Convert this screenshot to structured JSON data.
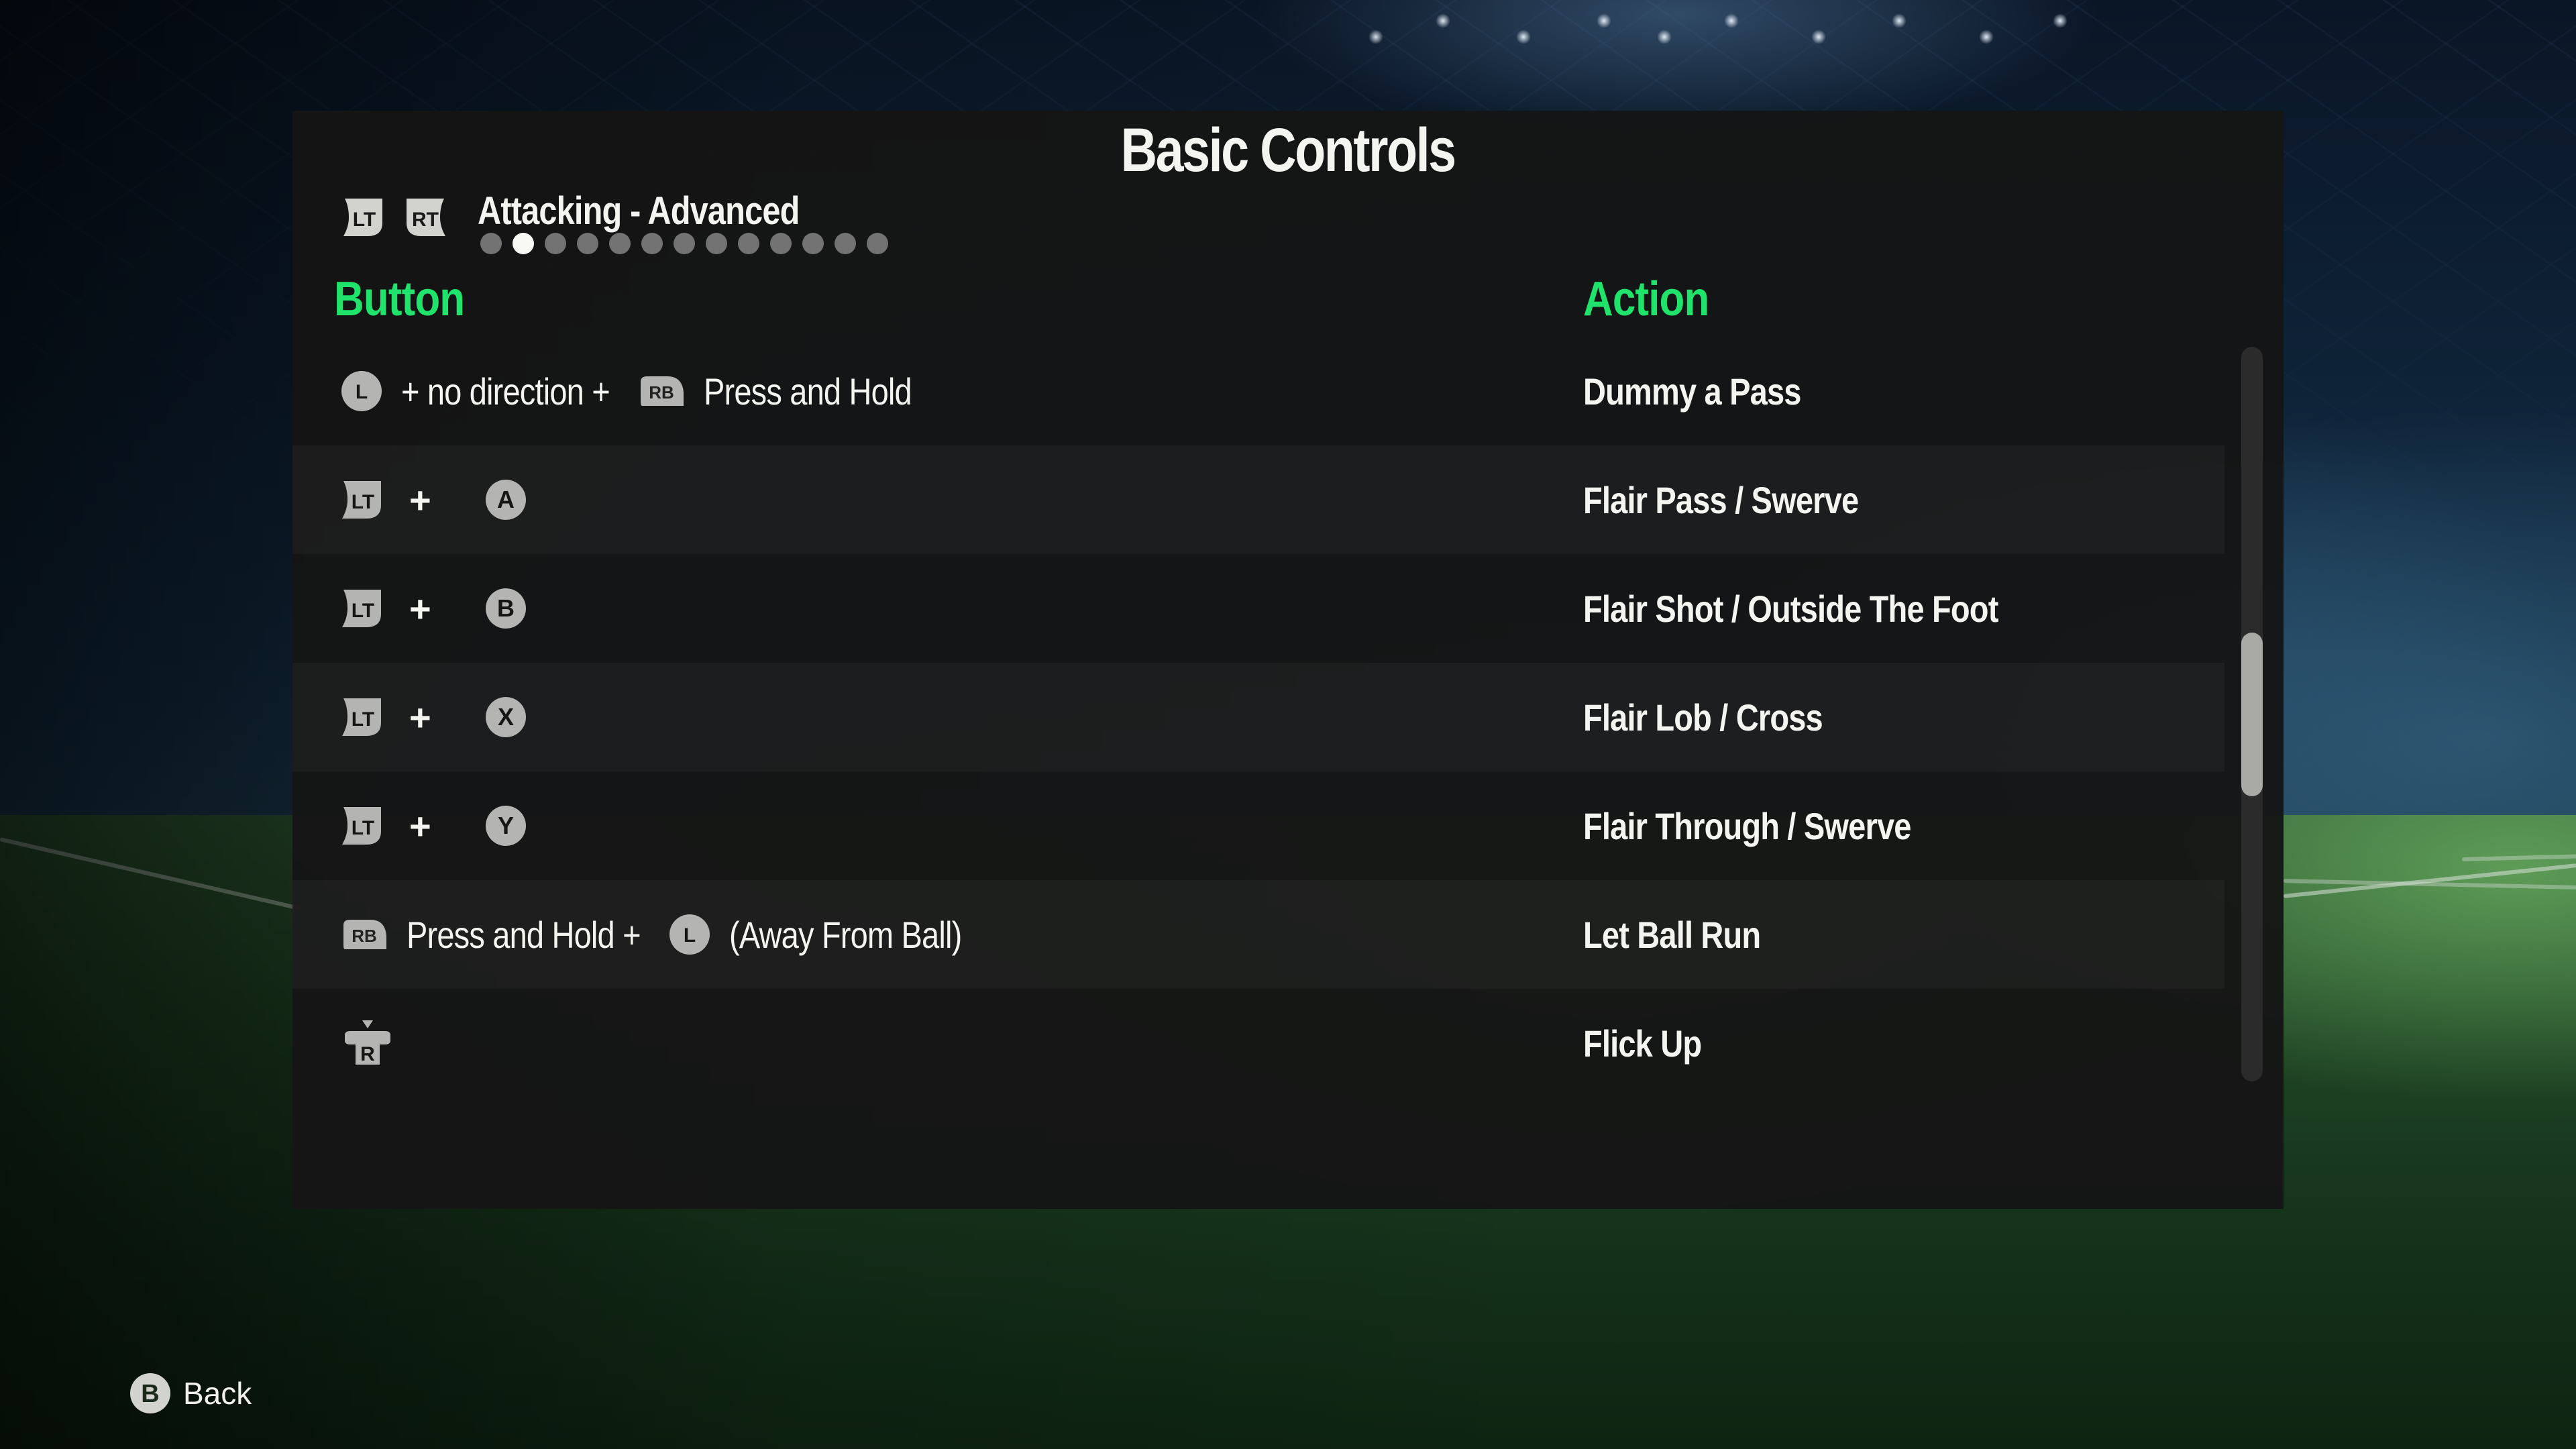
{
  "screen": {
    "title": "Basic Controls",
    "category": {
      "prev_trigger": "LT",
      "next_trigger": "RT",
      "label": "Attacking - Advanced",
      "page_count": 13,
      "active_page": 2
    },
    "columns": {
      "button": "Button",
      "action": "Action"
    },
    "accent_color": "#1fe36b",
    "rows": [
      {
        "button": [
          {
            "type": "icon",
            "icon": "left-stick-icon",
            "glyph": "L"
          },
          {
            "type": "text",
            "text": "+ no direction +"
          },
          {
            "type": "icon",
            "icon": "rb-bumper-icon",
            "glyph": "RB"
          },
          {
            "type": "text",
            "text": "Press and Hold"
          }
        ],
        "action": "Dummy a Pass"
      },
      {
        "button": [
          {
            "type": "icon",
            "icon": "lt-trigger-icon",
            "glyph": "LT"
          },
          {
            "type": "plus",
            "text": "+"
          },
          {
            "type": "icon",
            "icon": "a-button-icon",
            "glyph": "A"
          }
        ],
        "action": "Flair Pass / Swerve"
      },
      {
        "button": [
          {
            "type": "icon",
            "icon": "lt-trigger-icon",
            "glyph": "LT"
          },
          {
            "type": "plus",
            "text": "+"
          },
          {
            "type": "icon",
            "icon": "b-button-icon",
            "glyph": "B"
          }
        ],
        "action": "Flair Shot / Outside The Foot"
      },
      {
        "button": [
          {
            "type": "icon",
            "icon": "lt-trigger-icon",
            "glyph": "LT"
          },
          {
            "type": "plus",
            "text": "+"
          },
          {
            "type": "icon",
            "icon": "x-button-icon",
            "glyph": "X"
          }
        ],
        "action": "Flair Lob / Cross"
      },
      {
        "button": [
          {
            "type": "icon",
            "icon": "lt-trigger-icon",
            "glyph": "LT"
          },
          {
            "type": "plus",
            "text": "+"
          },
          {
            "type": "icon",
            "icon": "y-button-icon",
            "glyph": "Y"
          }
        ],
        "action": "Flair Through / Swerve"
      },
      {
        "button": [
          {
            "type": "icon",
            "icon": "rb-bumper-icon",
            "glyph": "RB"
          },
          {
            "type": "text",
            "text": "Press and Hold +"
          },
          {
            "type": "icon",
            "icon": "left-stick-icon",
            "glyph": "L"
          },
          {
            "type": "text",
            "text": "(Away From Ball)"
          }
        ],
        "action": "Let Ball Run"
      },
      {
        "button": [
          {
            "type": "icon",
            "icon": "right-stick-press-icon",
            "glyph": "R"
          }
        ],
        "action": "Flick Up"
      }
    ],
    "scroll_position_fraction": 0.5
  },
  "footer": {
    "back_glyph": "B",
    "back_label": "Back"
  }
}
